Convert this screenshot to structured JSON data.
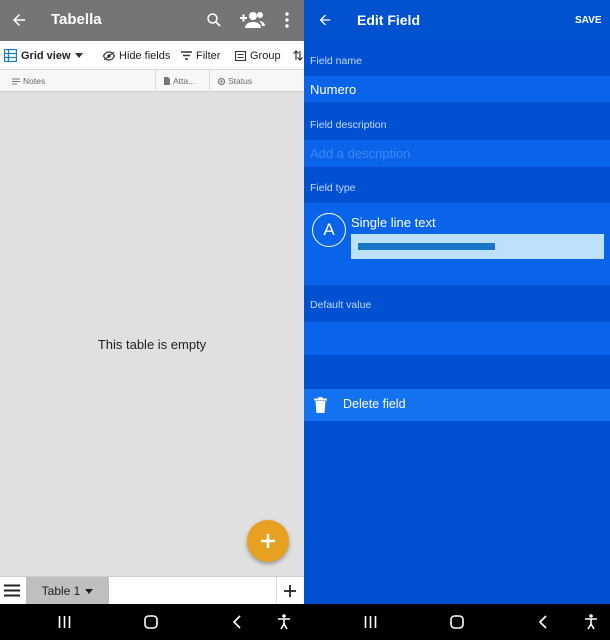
{
  "left": {
    "title": "Tabella",
    "toolbar": {
      "grid_view": "Grid view",
      "hide_fields": "Hide fields",
      "filter": "Filter",
      "group": "Group"
    },
    "columns": [
      "Notes",
      "Atta...",
      "Status"
    ],
    "empty_message": "This table is empty",
    "table_tab": "Table 1"
  },
  "right": {
    "title": "Edit Field",
    "save": "SAVE",
    "field_name_label": "Field name",
    "field_name_value": "Numero",
    "field_description_label": "Field description",
    "field_description_placeholder": "Add a description",
    "field_type_label": "Field type",
    "field_type_avatar": "A",
    "field_type_value": "Single line text",
    "default_value_label": "Default value",
    "delete_field": "Delete field"
  },
  "colors": {
    "left_appbar": "#757575",
    "right_bg": "#0050d2",
    "fab": "#e8a020",
    "field_bg": "#0a64ea",
    "selection": "#bde0fb"
  },
  "icons": [
    "back-arrow-icon",
    "search-icon",
    "add-collaborator-icon",
    "more-vert-icon",
    "grid-icon",
    "chevron-down-icon",
    "eye-icon",
    "filter-icon",
    "group-icon",
    "sort-icon",
    "notes-field-icon",
    "attachment-field-icon",
    "status-field-icon",
    "plus-icon",
    "hamburger-menu-icon",
    "trash-icon",
    "nav-recents-icon",
    "nav-home-icon",
    "nav-back-icon",
    "accessibility-icon"
  ]
}
